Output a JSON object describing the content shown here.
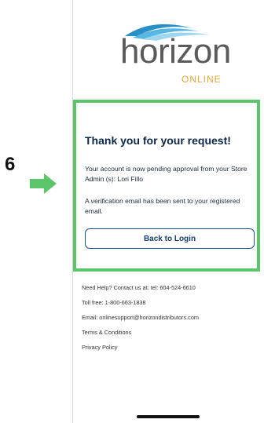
{
  "step": {
    "number": "6"
  },
  "logo": {
    "word": "horizon",
    "sub": "ONLINE"
  },
  "card": {
    "title": "Thank you for your request!",
    "message1": "Your account is now pending approval from your Store Admin (s): Lori Fillo",
    "message2": "A verification email has been sent to your registered email.",
    "back_button": "Back to Login"
  },
  "footer": {
    "help": "Need Help? Contact us at: tel: 604-524-6610",
    "tollfree": "Toll free: 1-800-663-1838",
    "email": "Email: onlinesupport@horizondistributors.com",
    "terms": "Terms & Conditions",
    "privacy": "Privacy Policy"
  },
  "colors": {
    "highlight_border": "#5cc56a",
    "arrow": "#5cc56a",
    "title": "#0d2744",
    "button_border": "#1a4f8a",
    "logo_text": "#5a5a5a",
    "logo_accent": "#e8a63a",
    "wave_blue": "#2a8fc7"
  },
  "icons": {
    "pointer": "right-arrow-icon",
    "logo_waves": "wave-icon"
  }
}
